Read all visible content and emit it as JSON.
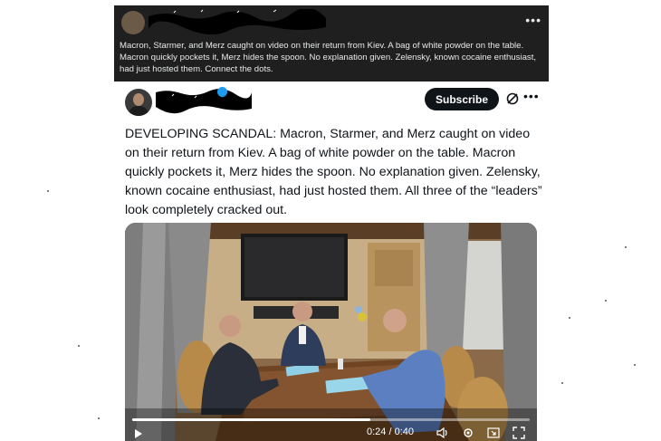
{
  "dark_post": {
    "text": "Macron, Starmer, and Merz caught on video on their return from Kiev. A bag of white powder on the table. Macron quickly pockets it, Merz hides the spoon. No explanation given. Zelensky, known cocaine enthusiast, had just hosted them. Connect the dots.",
    "more_icon": "more-horizontal-icon",
    "more_glyph": "•••"
  },
  "light_post": {
    "subscribe_label": "Subscribe",
    "more_glyph": "•••",
    "text": "DEVELOPING SCANDAL: Macron, Starmer, and Merz caught on video on their return from Kiev. A bag of white powder on the table. Macron quickly pockets it, Merz hides the spoon. No explanation given. Zelensky, known cocaine enthusiast, had just hosted them. All three of the “leaders” look completely cracked out.",
    "verified_color": "#1d9bf0"
  },
  "video": {
    "time": "0:24 / 0:40",
    "progress": 0.6,
    "icons": [
      "play-icon",
      "volume-icon",
      "settings-icon",
      "picture-in-picture-icon",
      "fullscreen-icon"
    ]
  },
  "colors": {
    "dark_bg": "#1f1f1f",
    "subscribe_bg": "#0f1419",
    "text": "#0f1419"
  }
}
